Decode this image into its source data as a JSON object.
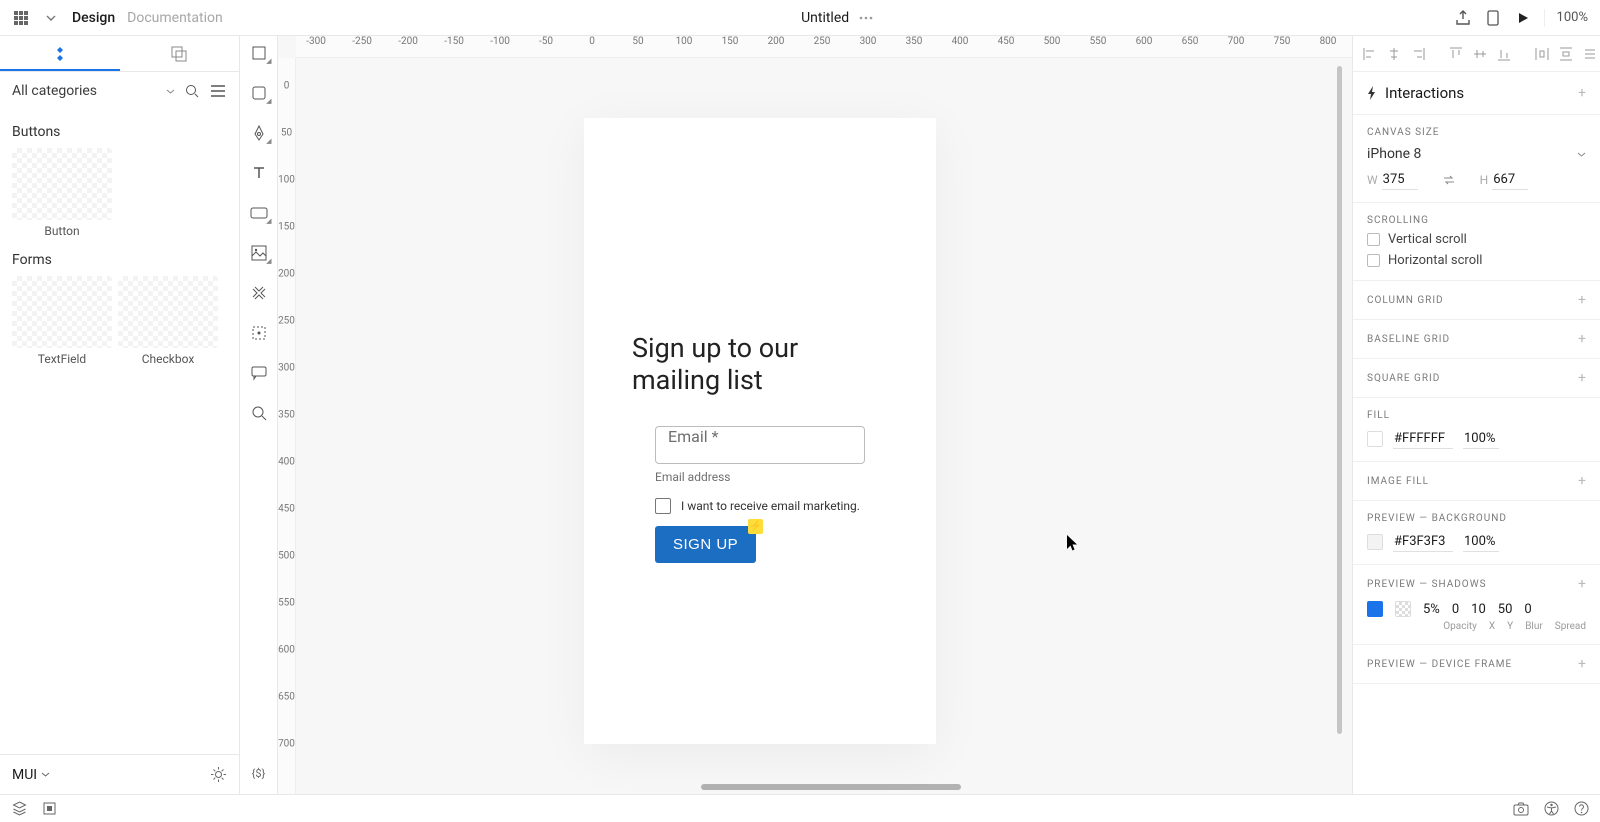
{
  "topbar": {
    "design_tab": "Design",
    "docs_tab": "Documentation",
    "title": "Untitled",
    "zoom": "100%"
  },
  "left_panel": {
    "category_dd": "All categories",
    "cat_buttons": "Buttons",
    "cat_forms": "Forms",
    "thumbs": {
      "button": "Button",
      "textfield": "TextField",
      "checkbox": "Checkbox"
    },
    "library": "MUI"
  },
  "canvas": {
    "ruler_h": [
      "-300",
      "-250",
      "-200",
      "-150",
      "-100",
      "-50",
      "0",
      "50",
      "100",
      "150",
      "200",
      "250",
      "300",
      "350",
      "400",
      "450",
      "500",
      "550",
      "600",
      "650",
      "700",
      "750",
      "800"
    ],
    "ruler_v": [
      "0",
      "50",
      "100",
      "150",
      "200",
      "250",
      "300",
      "350",
      "400",
      "450",
      "500",
      "550",
      "600",
      "650",
      "700"
    ],
    "form": {
      "title": "Sign up to our mailing list",
      "email_label": "Email *",
      "email_helper": "Email address",
      "marketing_chk": "I want to receive email marketing.",
      "submit": "SIGN UP"
    }
  },
  "right_panel": {
    "interactions_label": "Interactions",
    "canvas_size": {
      "title": "CANVAS SIZE",
      "preset": "iPhone 8",
      "w": "375",
      "h": "667"
    },
    "scrolling": {
      "title": "SCROLLING",
      "v": "Vertical scroll",
      "h": "Horizontal scroll"
    },
    "column_grid": "COLUMN GRID",
    "baseline_grid": "BASELINE GRID",
    "square_grid": "SQUARE GRID",
    "fill": {
      "title": "FILL",
      "hex": "#FFFFFF",
      "opacity": "100%"
    },
    "image_fill": "IMAGE FILL",
    "preview_bg": {
      "title": "PREVIEW — BACKGROUND",
      "hex": "#F3F3F3",
      "opacity": "100%"
    },
    "preview_shadows": {
      "title": "PREVIEW — SHADOWS",
      "opacity": "5%",
      "x": "0",
      "y": "10",
      "blur": "50",
      "spread": "0",
      "labels": {
        "opacity": "Opacity",
        "x": "X",
        "y": "Y",
        "blur": "Blur",
        "spread": "Spread"
      }
    },
    "preview_device_frame": "PREVIEW — DEVICE FRAME"
  }
}
